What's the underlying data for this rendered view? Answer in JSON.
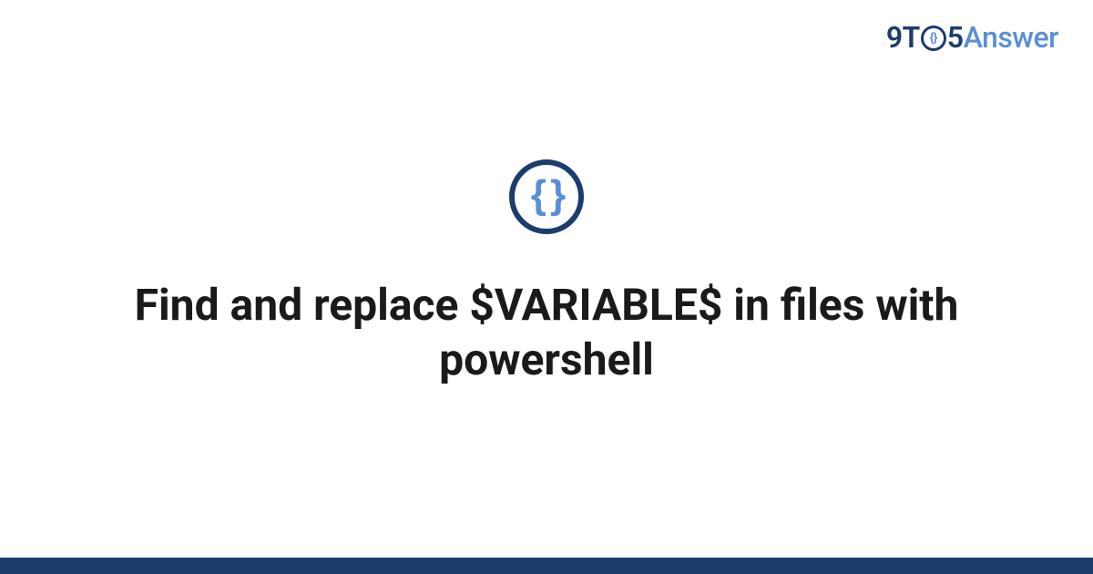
{
  "logo": {
    "part1": "9T",
    "clock_inner": "{}",
    "part2": "5",
    "part3": "Answer"
  },
  "icon": {
    "symbol": "{ }"
  },
  "title": "Find and replace $VARIABLE$ in files with powershell",
  "colors": {
    "primary": "#1a3d6d",
    "accent": "#5a8fd6",
    "text": "#1a1a1a"
  }
}
